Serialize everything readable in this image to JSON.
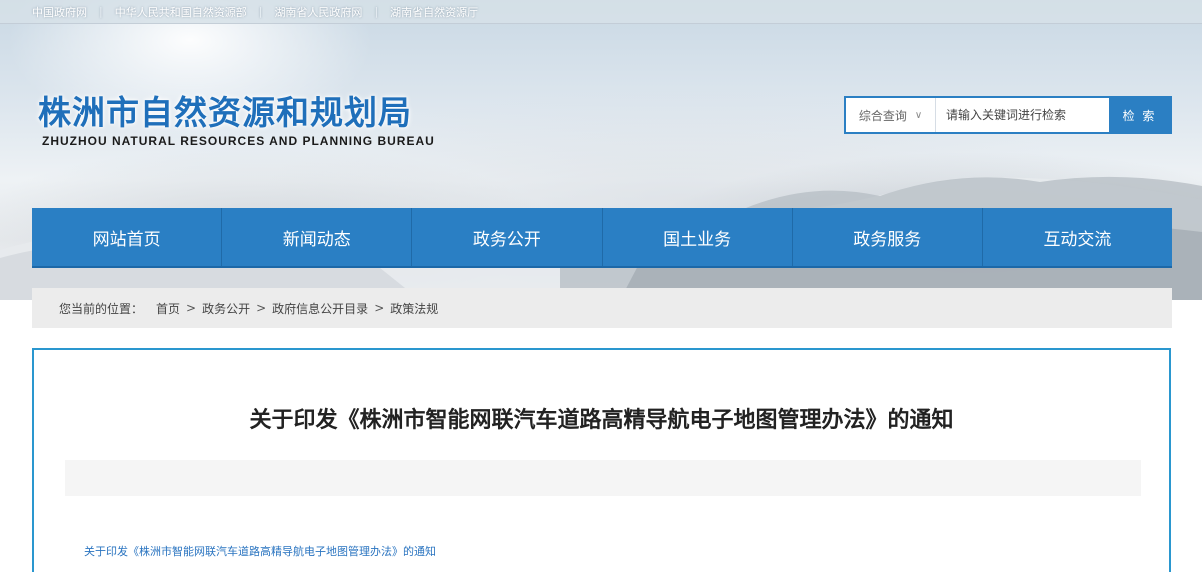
{
  "topbar": {
    "links": [
      "中国政府网",
      "中华人民共和国自然资源部",
      "湖南省人民政府网",
      "湖南省自然资源厅"
    ]
  },
  "logo": {
    "cn": "株洲市自然资源和规划局",
    "en": "ZHUZHOU NATURAL RESOURCES AND PLANNING BUREAU"
  },
  "search": {
    "scope_label": "综合查询",
    "placeholder": "请输入关键词进行检索",
    "button_label": "检 索"
  },
  "nav": {
    "items": [
      "网站首页",
      "新闻动态",
      "政务公开",
      "国土业务",
      "政务服务",
      "互动交流"
    ]
  },
  "breadcrumb": {
    "lead": "您当前的位置：",
    "items": [
      "首页",
      "政务公开",
      "政府信息公开目录",
      "政策法规"
    ]
  },
  "article": {
    "title": "关于印发《株洲市智能网联汽车道路高精导航电子地图管理办法》的通知",
    "attachment_link": "关于印发《株洲市智能网联汽车道路高精导航电子地图管理办法》的通知"
  },
  "colors": {
    "primary": "#2a7fc4",
    "logo_blue": "#1f6fba",
    "content_border": "#2a97cf",
    "link": "#2a74c0"
  }
}
